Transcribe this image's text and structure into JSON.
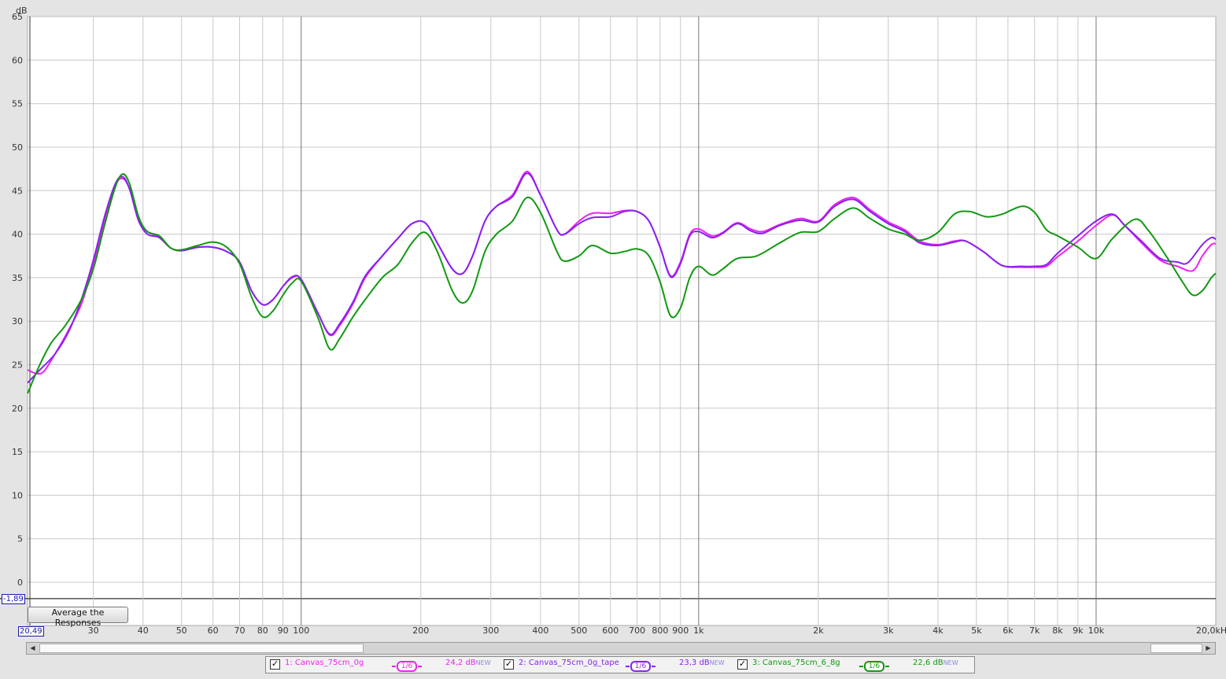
{
  "chart_data": {
    "type": "line",
    "y_unit": "dB",
    "x_unit": "kHz",
    "x_scale": "log",
    "xlim": [
      20.49,
      20000
    ],
    "ylim": [
      -1.89,
      66
    ],
    "y_ticks": [
      0,
      5,
      10,
      15,
      20,
      25,
      30,
      35,
      40,
      45,
      50,
      55,
      60,
      65
    ],
    "x_ticks": [
      {
        "f": 30,
        "label": "30"
      },
      {
        "f": 40,
        "label": "40"
      },
      {
        "f": 50,
        "label": "50"
      },
      {
        "f": 60,
        "label": "60"
      },
      {
        "f": 70,
        "label": "70"
      },
      {
        "f": 80,
        "label": "80"
      },
      {
        "f": 90,
        "label": "90"
      },
      {
        "f": 100,
        "label": "100"
      },
      {
        "f": 200,
        "label": "200"
      },
      {
        "f": 300,
        "label": "300"
      },
      {
        "f": 400,
        "label": "400"
      },
      {
        "f": 500,
        "label": "500"
      },
      {
        "f": 600,
        "label": "600"
      },
      {
        "f": 700,
        "label": "700"
      },
      {
        "f": 800,
        "label": "800"
      },
      {
        "f": 900,
        "label": "900"
      },
      {
        "f": 1000,
        "label": "1k"
      },
      {
        "f": 2000,
        "label": "2k"
      },
      {
        "f": 3000,
        "label": "3k"
      },
      {
        "f": 4000,
        "label": "4k"
      },
      {
        "f": 5000,
        "label": "5k"
      },
      {
        "f": 6000,
        "label": "6k"
      },
      {
        "f": 7000,
        "label": "7k"
      },
      {
        "f": 8000,
        "label": "8k"
      },
      {
        "f": 9000,
        "label": "9k"
      },
      {
        "f": 10000,
        "label": "10k"
      }
    ],
    "x_end_label": "20,0kHz",
    "x_start_label": "20,49",
    "y_bottom_label": "-1,89",
    "grid": true,
    "series": [
      {
        "name": "1: Canvas_75cm_0g",
        "color": "#ee22ee",
        "points": [
          [
            20.5,
            24.4
          ],
          [
            21.5,
            24.0
          ],
          [
            22.5,
            24.2
          ],
          [
            24,
            26.2
          ],
          [
            26,
            29.0
          ],
          [
            28,
            32.0
          ],
          [
            30,
            36.5
          ],
          [
            32,
            41.5
          ],
          [
            34,
            45.5
          ],
          [
            35.5,
            46.4
          ],
          [
            37,
            45.2
          ],
          [
            39,
            41.5
          ],
          [
            41,
            40.3
          ],
          [
            44,
            39.6
          ],
          [
            47,
            38.4
          ],
          [
            50,
            38.1
          ],
          [
            55,
            38.5
          ],
          [
            60,
            38.5
          ],
          [
            65,
            38.0
          ],
          [
            70,
            36.8
          ],
          [
            75,
            33.5
          ],
          [
            80,
            31.9
          ],
          [
            85,
            32.5
          ],
          [
            90,
            34.0
          ],
          [
            95,
            35.0
          ],
          [
            100,
            34.8
          ],
          [
            110,
            31.0
          ],
          [
            118,
            28.4
          ],
          [
            125,
            29.5
          ],
          [
            135,
            32.0
          ],
          [
            145,
            35.0
          ],
          [
            160,
            37.5
          ],
          [
            175,
            39.5
          ],
          [
            190,
            41.2
          ],
          [
            205,
            41.3
          ],
          [
            220,
            39.0
          ],
          [
            240,
            36.0
          ],
          [
            255,
            35.5
          ],
          [
            270,
            37.5
          ],
          [
            290,
            41.5
          ],
          [
            310,
            43.2
          ],
          [
            340,
            44.5
          ],
          [
            370,
            47.2
          ],
          [
            400,
            44.5
          ],
          [
            440,
            40.5
          ],
          [
            460,
            40.0
          ],
          [
            500,
            41.5
          ],
          [
            540,
            42.4
          ],
          [
            600,
            42.4
          ],
          [
            650,
            42.7
          ],
          [
            700,
            42.6
          ],
          [
            750,
            41.5
          ],
          [
            800,
            38.5
          ],
          [
            850,
            35.2
          ],
          [
            900,
            36.8
          ],
          [
            950,
            40.0
          ],
          [
            1000,
            40.6
          ],
          [
            1080,
            39.8
          ],
          [
            1150,
            40.2
          ],
          [
            1250,
            41.3
          ],
          [
            1350,
            40.6
          ],
          [
            1450,
            40.3
          ],
          [
            1600,
            41.1
          ],
          [
            1800,
            41.8
          ],
          [
            2000,
            41.5
          ],
          [
            2200,
            43.4
          ],
          [
            2450,
            44.2
          ],
          [
            2700,
            42.8
          ],
          [
            3000,
            41.4
          ],
          [
            3300,
            40.5
          ],
          [
            3600,
            39.2
          ],
          [
            4000,
            38.8
          ],
          [
            4400,
            39.2
          ],
          [
            4700,
            39.2
          ],
          [
            5200,
            38.0
          ],
          [
            5800,
            36.4
          ],
          [
            6500,
            36.2
          ],
          [
            7000,
            36.2
          ],
          [
            7500,
            36.3
          ],
          [
            8000,
            37.4
          ],
          [
            9000,
            39.2
          ],
          [
            10000,
            41.0
          ],
          [
            11000,
            42.2
          ],
          [
            11800,
            41.0
          ],
          [
            13000,
            39.0
          ],
          [
            14500,
            37.0
          ],
          [
            16000,
            36.3
          ],
          [
            17500,
            35.8
          ],
          [
            18500,
            37.5
          ],
          [
            19500,
            38.8
          ],
          [
            20000,
            38.9
          ]
        ]
      },
      {
        "name": "2: Canvas_75cm_0g_tape",
        "color": "#8822ee",
        "points": [
          [
            20.5,
            22.9
          ],
          [
            22,
            24.4
          ],
          [
            24,
            26.2
          ],
          [
            26,
            28.8
          ],
          [
            28,
            32.5
          ],
          [
            30,
            37.0
          ],
          [
            32,
            42.0
          ],
          [
            34,
            45.7
          ],
          [
            35.5,
            46.6
          ],
          [
            37,
            45.2
          ],
          [
            39,
            41.6
          ],
          [
            41,
            40.0
          ],
          [
            44,
            39.6
          ],
          [
            47,
            38.4
          ],
          [
            50,
            38.1
          ],
          [
            55,
            38.5
          ],
          [
            60,
            38.5
          ],
          [
            65,
            38.0
          ],
          [
            70,
            36.8
          ],
          [
            75,
            33.5
          ],
          [
            80,
            31.9
          ],
          [
            85,
            32.5
          ],
          [
            90,
            34.0
          ],
          [
            95,
            35.1
          ],
          [
            100,
            34.8
          ],
          [
            110,
            31.0
          ],
          [
            118,
            28.5
          ],
          [
            125,
            29.7
          ],
          [
            135,
            32.2
          ],
          [
            145,
            35.2
          ],
          [
            160,
            37.5
          ],
          [
            175,
            39.5
          ],
          [
            190,
            41.2
          ],
          [
            205,
            41.3
          ],
          [
            220,
            39.0
          ],
          [
            240,
            36.0
          ],
          [
            255,
            35.5
          ],
          [
            270,
            37.5
          ],
          [
            290,
            41.5
          ],
          [
            310,
            43.2
          ],
          [
            340,
            44.3
          ],
          [
            370,
            47.0
          ],
          [
            400,
            44.5
          ],
          [
            440,
            40.5
          ],
          [
            460,
            40.0
          ],
          [
            500,
            41.2
          ],
          [
            540,
            41.9
          ],
          [
            600,
            42.0
          ],
          [
            650,
            42.6
          ],
          [
            700,
            42.6
          ],
          [
            750,
            41.5
          ],
          [
            800,
            38.5
          ],
          [
            850,
            35.1
          ],
          [
            900,
            36.6
          ],
          [
            950,
            39.8
          ],
          [
            1000,
            40.3
          ],
          [
            1080,
            39.6
          ],
          [
            1150,
            40.1
          ],
          [
            1250,
            41.2
          ],
          [
            1350,
            40.4
          ],
          [
            1450,
            40.1
          ],
          [
            1600,
            41.0
          ],
          [
            1800,
            41.6
          ],
          [
            2000,
            41.4
          ],
          [
            2200,
            43.2
          ],
          [
            2450,
            44.0
          ],
          [
            2700,
            42.6
          ],
          [
            3000,
            41.2
          ],
          [
            3300,
            40.3
          ],
          [
            3600,
            39.0
          ],
          [
            4000,
            38.7
          ],
          [
            4400,
            39.1
          ],
          [
            4700,
            39.2
          ],
          [
            5200,
            38.0
          ],
          [
            5800,
            36.4
          ],
          [
            6500,
            36.3
          ],
          [
            7000,
            36.3
          ],
          [
            7500,
            36.5
          ],
          [
            8000,
            37.8
          ],
          [
            9000,
            39.8
          ],
          [
            10000,
            41.5
          ],
          [
            11000,
            42.3
          ],
          [
            11800,
            41.0
          ],
          [
            13000,
            39.2
          ],
          [
            14500,
            37.2
          ],
          [
            16000,
            36.8
          ],
          [
            17000,
            36.7
          ],
          [
            18500,
            38.8
          ],
          [
            19500,
            39.6
          ],
          [
            20000,
            39.4
          ]
        ]
      },
      {
        "name": "3: Canvas_75cm_6_8g",
        "color": "#119911",
        "points": [
          [
            20.5,
            21.7
          ],
          [
            22,
            25.0
          ],
          [
            23.5,
            27.5
          ],
          [
            25.5,
            29.5
          ],
          [
            28,
            32.5
          ],
          [
            30,
            36.0
          ],
          [
            32,
            41.0
          ],
          [
            34,
            45.3
          ],
          [
            35.5,
            46.9
          ],
          [
            37,
            45.8
          ],
          [
            39,
            42.0
          ],
          [
            41,
            40.3
          ],
          [
            44,
            39.8
          ],
          [
            47,
            38.4
          ],
          [
            50,
            38.2
          ],
          [
            55,
            38.7
          ],
          [
            60,
            39.1
          ],
          [
            65,
            38.5
          ],
          [
            70,
            36.6
          ],
          [
            75,
            32.8
          ],
          [
            80,
            30.5
          ],
          [
            85,
            31.2
          ],
          [
            90,
            33.0
          ],
          [
            95,
            34.4
          ],
          [
            100,
            34.6
          ],
          [
            110,
            30.5
          ],
          [
            118,
            26.8
          ],
          [
            125,
            28.0
          ],
          [
            135,
            30.5
          ],
          [
            145,
            32.5
          ],
          [
            160,
            35.0
          ],
          [
            175,
            36.5
          ],
          [
            190,
            39.0
          ],
          [
            205,
            40.2
          ],
          [
            220,
            38.0
          ],
          [
            240,
            33.5
          ],
          [
            255,
            32.1
          ],
          [
            270,
            33.5
          ],
          [
            290,
            38.0
          ],
          [
            310,
            40.0
          ],
          [
            340,
            41.5
          ],
          [
            370,
            44.2
          ],
          [
            400,
            42.5
          ],
          [
            440,
            38.0
          ],
          [
            460,
            36.9
          ],
          [
            500,
            37.5
          ],
          [
            540,
            38.7
          ],
          [
            600,
            37.8
          ],
          [
            650,
            38.0
          ],
          [
            700,
            38.3
          ],
          [
            750,
            37.5
          ],
          [
            800,
            34.5
          ],
          [
            850,
            30.6
          ],
          [
            900,
            31.5
          ],
          [
            950,
            35.0
          ],
          [
            1000,
            36.3
          ],
          [
            1080,
            35.3
          ],
          [
            1150,
            36.0
          ],
          [
            1250,
            37.2
          ],
          [
            1400,
            37.5
          ],
          [
            1600,
            39.0
          ],
          [
            1800,
            40.2
          ],
          [
            2000,
            40.3
          ],
          [
            2200,
            41.8
          ],
          [
            2450,
            43.0
          ],
          [
            2700,
            41.8
          ],
          [
            3000,
            40.6
          ],
          [
            3300,
            40.0
          ],
          [
            3600,
            39.3
          ],
          [
            4000,
            40.2
          ],
          [
            4400,
            42.3
          ],
          [
            4800,
            42.6
          ],
          [
            5300,
            42.0
          ],
          [
            5800,
            42.3
          ],
          [
            6500,
            43.2
          ],
          [
            7000,
            42.5
          ],
          [
            7500,
            40.5
          ],
          [
            8000,
            39.8
          ],
          [
            9000,
            38.5
          ],
          [
            10000,
            37.2
          ],
          [
            11000,
            39.5
          ],
          [
            12500,
            41.7
          ],
          [
            13500,
            40.5
          ],
          [
            15000,
            37.5
          ],
          [
            16500,
            34.5
          ],
          [
            17500,
            33.0
          ],
          [
            18500,
            33.5
          ],
          [
            19500,
            35.0
          ],
          [
            20000,
            35.5
          ]
        ]
      }
    ]
  },
  "ui": {
    "average_button": "Average the Responses",
    "y_unit_label": "dB",
    "legend": [
      {
        "name": "1: Canvas_75cm_0g",
        "smoothing": "1/6",
        "level": "24,2 dB",
        "tag": "NEW",
        "color": "#ee22ee"
      },
      {
        "name": "2: Canvas_75cm_0g_tape",
        "smoothing": "1/6",
        "level": "23,3 dB",
        "tag": "NEW",
        "color": "#8822ee"
      },
      {
        "name": "3: Canvas_75cm_6_8g",
        "smoothing": "1/6",
        "level": "22,6 dB",
        "tag": "NEW",
        "color": "#119911"
      }
    ],
    "check_mark": "✓",
    "scroll_left": "◀",
    "scroll_right": "▶"
  }
}
